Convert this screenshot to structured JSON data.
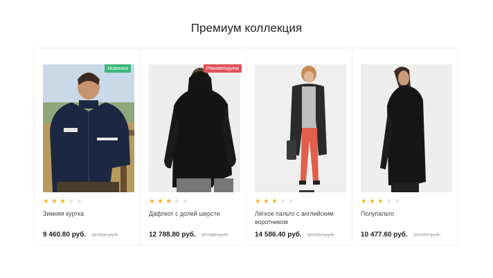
{
  "section": {
    "title": "Премиум коллекция"
  },
  "products": [
    {
      "name": "Зимняя куртка",
      "price": "9 460.80 руб.",
      "old_price": "11 826 руб.",
      "badge": "Новинка",
      "rating": 3,
      "rating_max": 5
    },
    {
      "name": "Дафлкот с долей шерсти",
      "price": "12 788.80 руб.",
      "old_price": "15 986 руб.",
      "badge": "Рекомендуем",
      "rating": 3,
      "rating_max": 5
    },
    {
      "name": "Лёгкое пальто с английским воротником",
      "price": "14 586.40 руб.",
      "old_price": "18 233 руб.",
      "badge": "",
      "rating": 3,
      "rating_max": 5
    },
    {
      "name": "Полупальто",
      "price": "10 477.60 руб.",
      "old_price": "13 097 руб.",
      "badge": "",
      "rating": 3,
      "rating_max": 5
    }
  ],
  "colors": {
    "badge_new": "#3cb878",
    "badge_recommended": "#e0525a",
    "star_on": "#f3b52b",
    "star_off": "#e2e2e2"
  }
}
